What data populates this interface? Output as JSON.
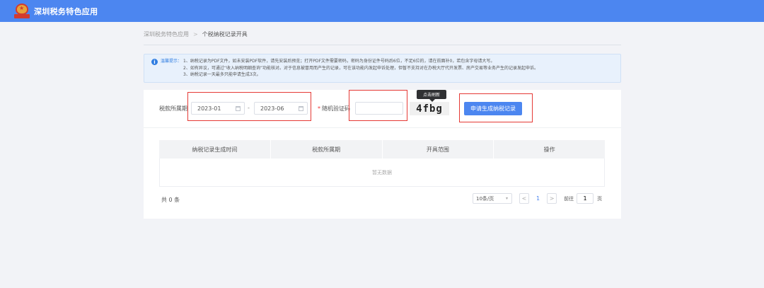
{
  "app": {
    "title": "深圳税务特色应用"
  },
  "breadcrumb": {
    "root": "深圳税务特色应用",
    "separator": ">",
    "current": "个税纳税记录开具"
  },
  "notice": {
    "label": "温馨提示：",
    "lines": [
      "1、纳税记录为PDF文件，如未安装PDF软件，请先安装后预览；打开PDF文件需要密码，密码为身份证件号码后6位，不足6位的，请在前面补0，若包含字母请大写。",
      "2、如有异议，可通过“收入纳税明细查询”功能核对。对于信息被冒用而产生的记录，可在该功能内发起申诉处理，但暂不支持对在办税大厅代开发票、房产交易等业务产生的记录发起申诉。",
      "3、纳税记录一天最多只能申请生成3次。"
    ]
  },
  "form": {
    "period_label": "税款所属期",
    "start": "2023-01",
    "dash": "-",
    "end": "2023-06",
    "required_mark": "*",
    "captcha_label": "随机验证码",
    "captcha_value": "",
    "captcha_text": "4fbg",
    "tooltip": "点击刷新",
    "submit_label": "申请生成纳税记录"
  },
  "table": {
    "columns": [
      "纳税记录生成时间",
      "税款所属期",
      "开具范围",
      "操作"
    ],
    "empty_text": "暂无数据"
  },
  "pagination": {
    "total": "共 0 条",
    "page_size": "10条/页",
    "prev": "<",
    "current_page": "1",
    "next": ">",
    "goto_label": "前往",
    "goto_value": "1",
    "goto_suffix": "页"
  },
  "colors": {
    "brand": "#4c86f0",
    "highlight": "#e53935",
    "notice_bg": "#e8f1fc"
  }
}
